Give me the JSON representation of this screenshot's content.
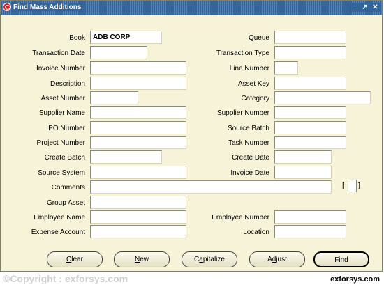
{
  "window": {
    "title": "Find Mass Additions",
    "controls": [
      "minimize-icon",
      "maximize-icon",
      "close-icon"
    ]
  },
  "fields": {
    "book": {
      "label": "Book",
      "value": "ADB CORP"
    },
    "queue": {
      "label": "Queue",
      "value": ""
    },
    "transaction_date": {
      "label": "Transaction Date",
      "value": ""
    },
    "transaction_type": {
      "label": "Transaction Type",
      "value": ""
    },
    "invoice_number": {
      "label": "Invoice Number",
      "value": ""
    },
    "line_number": {
      "label": "Line Number",
      "value": ""
    },
    "description": {
      "label": "Description",
      "value": ""
    },
    "asset_key": {
      "label": "Asset Key",
      "value": ""
    },
    "asset_number": {
      "label": "Asset Number",
      "value": ""
    },
    "category": {
      "label": "Category",
      "value": ""
    },
    "supplier_name": {
      "label": "Supplier Name",
      "value": ""
    },
    "supplier_number": {
      "label": "Supplier Number",
      "value": ""
    },
    "po_number": {
      "label": "PO Number",
      "value": ""
    },
    "source_batch": {
      "label": "Source Batch",
      "value": ""
    },
    "project_number": {
      "label": "Project Number",
      "value": ""
    },
    "task_number": {
      "label": "Task Number",
      "value": ""
    },
    "create_batch": {
      "label": "Create Batch",
      "value": ""
    },
    "create_date": {
      "label": "Create Date",
      "value": ""
    },
    "source_system": {
      "label": "Source System",
      "value": ""
    },
    "invoice_date": {
      "label": "Invoice Date",
      "value": ""
    },
    "comments": {
      "label": "Comments",
      "value": ""
    },
    "group_asset": {
      "label": "Group Asset",
      "value": ""
    },
    "employee_name": {
      "label": "Employee Name",
      "value": ""
    },
    "employee_number": {
      "label": "Employee Number",
      "value": ""
    },
    "expense_account": {
      "label": "Expense Account",
      "value": ""
    },
    "location": {
      "label": "Location",
      "value": ""
    }
  },
  "flex_field": {
    "open": "[",
    "close": "]"
  },
  "buttons": {
    "clear": {
      "mnemonic": "C",
      "rest": "lear"
    },
    "new": {
      "mnemonic": "N",
      "rest": "ew"
    },
    "capitalize": {
      "pre": "C",
      "mnemonic": "a",
      "rest": "pitalize"
    },
    "adjust": {
      "pre": "A",
      "mnemonic": "d",
      "rest": "just"
    },
    "find": {
      "label": "Find"
    }
  },
  "footer": {
    "copyright": "©Copyright : exforsys.com",
    "brand": "exforsys.com"
  }
}
